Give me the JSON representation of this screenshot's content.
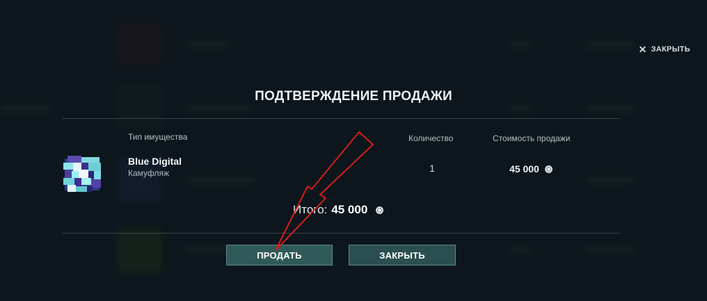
{
  "header": {
    "close_label": "ЗАКРЫТЬ",
    "title": "ПОДТВЕРЖДЕНИЕ ПРОДАЖИ"
  },
  "table": {
    "col_type": "Тип имущества",
    "col_qty": "Количество",
    "col_price": "Стоимость продажи"
  },
  "item": {
    "name": "Blue Digital",
    "type": "Камуфляж",
    "quantity": "1",
    "price": "45 000",
    "icon": "camouflage-pixel-icon"
  },
  "total": {
    "label": "Итого:",
    "value": "45 000"
  },
  "buttons": {
    "sell_label": "ПРОДАТЬ",
    "close_label": "ЗАКРЫТЬ"
  },
  "colors": {
    "background": "#121c22",
    "button": "#305a5a",
    "button_border": "#5f8a88",
    "arrow": "#d11f1f"
  }
}
